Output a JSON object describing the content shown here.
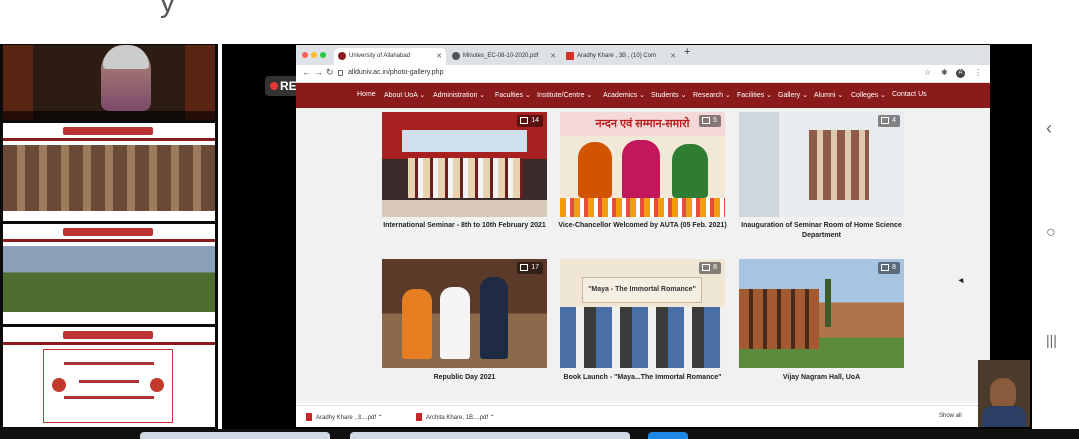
{
  "zoom_controls": {
    "rec_label": "REC"
  },
  "browser": {
    "tabs": [
      {
        "label": "University of Allahabad",
        "active": true
      },
      {
        "label": "Minutes_EC-08-10-2020.pdf",
        "active": false
      },
      {
        "label": "Aradhy Khare , 3B , (10) Com",
        "active": false
      }
    ],
    "new_tab_symbol": "+",
    "url": "allduniv.ac.in/photo-gallery.php",
    "profile_initial": "A"
  },
  "site_nav": {
    "items": [
      "Home",
      "About UoA ⌄",
      "Administration ⌄",
      "Faculties ⌄",
      "Institute/Centre ⌄",
      "Academics ⌄",
      "Students ⌄",
      "Research ⌄",
      "Facilities ⌄",
      "Gallery ⌄",
      "Alumni ⌄",
      "Colleges ⌄",
      "Contact Us"
    ]
  },
  "gallery": [
    {
      "caption": "International Seminar - 8th to 10th February 2021",
      "count": "14"
    },
    {
      "caption": "Vice-Chancellor Welcomed by AUTA (05 Feb. 2021)",
      "count": "5"
    },
    {
      "caption": "Inauguration of Seminar Room of Home Science Department",
      "count": "4"
    },
    {
      "caption": "Republic Day 2021",
      "count": "17"
    },
    {
      "caption": "Book Launch - \"Maya...The Immortal Romance\"",
      "count": "8"
    },
    {
      "caption": "Vijay Nagram Hall, UoA",
      "count": "8"
    }
  ],
  "photo_text": {
    "banner_hindi": "नन्दन एवं सम्मान-समारो",
    "book_banner": "\"Maya - The Immortal Romance\""
  },
  "downloads": {
    "items": [
      "Aradhy Khare , 3....pdf",
      "Archita Khare, 1B....pdf"
    ],
    "show_all": "Show all"
  },
  "colors": {
    "brand": "#8b1a1a",
    "rec_dot": "#e53935"
  }
}
